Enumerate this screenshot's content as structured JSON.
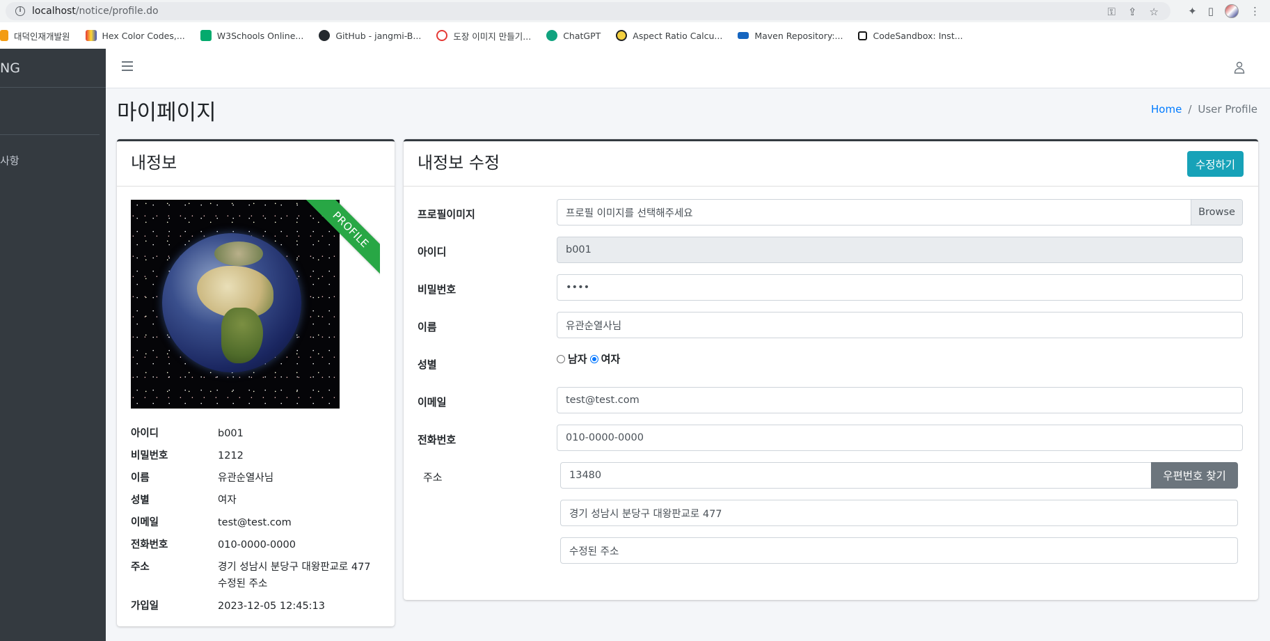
{
  "browser": {
    "url_host": "localhost",
    "url_path": "/notice/profile.do",
    "bookmarks": [
      {
        "label": "대덕인재개발원",
        "color": "#f39c12"
      },
      {
        "label": "Hex Color Codes,...",
        "color": "#3f51b5"
      },
      {
        "label": "W3Schools Online...",
        "color": "#04aa6d"
      },
      {
        "label": "GitHub - jangmi-B...",
        "color": "#24292e"
      },
      {
        "label": "도장 이미지 만들기...",
        "color": "#e53935"
      },
      {
        "label": "ChatGPT",
        "color": "#10a37f"
      },
      {
        "label": "Aspect Ratio Calcu...",
        "color": "#f4d03f"
      },
      {
        "label": "Maven Repository:...",
        "color": "#1565c0"
      },
      {
        "label": "CodeSandbox: Inst...",
        "color": "#151515"
      }
    ]
  },
  "sidebar": {
    "brand": "NG",
    "nav_item": "사항"
  },
  "header": {
    "page_title": "마이페이지",
    "breadcrumb_home": "Home",
    "breadcrumb_sep": "/",
    "breadcrumb_active": "User Profile"
  },
  "profile_card": {
    "title": "내정보",
    "ribbon": "PROFILE",
    "rows": [
      {
        "key": "아이디",
        "value": "b001"
      },
      {
        "key": "비밀번호",
        "value": "1212"
      },
      {
        "key": "이름",
        "value": "유관순열사님"
      },
      {
        "key": "성별",
        "value": "여자"
      },
      {
        "key": "이메일",
        "value": "test@test.com"
      },
      {
        "key": "전화번호",
        "value": "010-0000-0000"
      },
      {
        "key": "주소",
        "value": "경기 성남시 분당구 대왕판교로 477 수정된 주소"
      },
      {
        "key": "가입일",
        "value": "2023-12-05 12:45:13"
      }
    ]
  },
  "edit_card": {
    "title": "내정보 수정",
    "edit_button": "수정하기",
    "labels": {
      "profile_image": "프로필이미지",
      "user_id": "아이디",
      "password": "비밀번호",
      "name": "이름",
      "gender": "성별",
      "email": "이메일",
      "phone": "전화번호",
      "address": "주소"
    },
    "file_placeholder": "프로필 이미지를 선택해주세요",
    "browse_label": "Browse",
    "user_id_value": "b001",
    "password_value": "••••",
    "name_value": "유관순열사님",
    "gender_options": [
      {
        "label": "남자",
        "checked": false
      },
      {
        "label": "여자",
        "checked": true
      }
    ],
    "email_value": "test@test.com",
    "phone_value": "010-0000-0000",
    "zipcode_value": "13480",
    "zip_button": "우편번호 찾기",
    "address1_value": "경기 성남시 분당구 대왕판교로 477",
    "address2_value": "수정된 주소"
  },
  "colors": {
    "accent": "#17a2b8",
    "ribbon": "#28a745",
    "sidebar": "#343a40",
    "link": "#007bff"
  }
}
